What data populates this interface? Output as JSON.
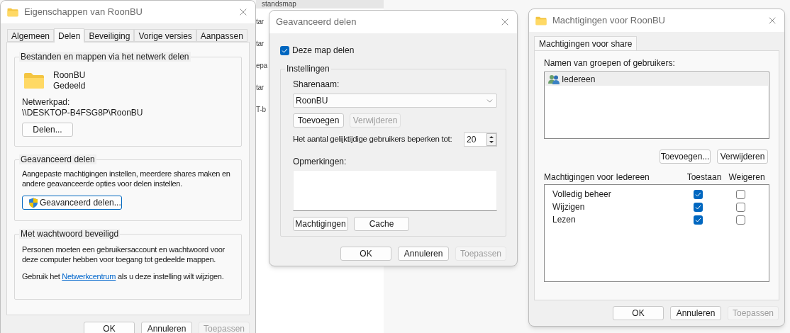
{
  "background_window": {
    "header": "standsmap",
    "items": [
      "tar",
      "tar",
      "epa",
      "tar",
      "T-b"
    ]
  },
  "properties_dialog": {
    "title": "Eigenschappen van RoonBU",
    "tabs": [
      {
        "label": "Algemeen",
        "selected": false
      },
      {
        "label": "Delen",
        "selected": true
      },
      {
        "label": "Beveiliging",
        "selected": false
      },
      {
        "label": "Vorige versies",
        "selected": false
      },
      {
        "label": "Aanpassen",
        "selected": false
      }
    ],
    "network_sharing": {
      "heading": "Bestanden en mappen via het netwerk delen",
      "folder_name": "RoonBU",
      "folder_status": "Gedeeld",
      "path_label": "Netwerkpad:",
      "path": "\\\\DESKTOP-B4FSG8P\\RoonBU",
      "share_button": "Delen..."
    },
    "advanced_sharing": {
      "heading": "Geavanceerd delen",
      "description": "Aangepaste machtigingen instellen, meerdere shares maken en andere geavanceerde opties voor delen instellen.",
      "button": "Geavanceerd delen..."
    },
    "password_protection": {
      "heading": "Met wachtwoord beveiligd",
      "description": "Personen moeten een gebruikersaccount en wachtwoord voor deze computer hebben voor toegang tot gedeelde mappen.",
      "hint_before": "Gebruik het",
      "hint_link": "Netwerkcentrum",
      "hint_after": "als u deze instelling wilt wijzigen."
    },
    "buttons": [
      {
        "label": "OK",
        "disabled": false
      },
      {
        "label": "Annuleren",
        "disabled": false
      },
      {
        "label": "Toepassen",
        "disabled": true
      }
    ]
  },
  "advanced_dialog": {
    "title": "Geavanceerd delen",
    "share_checkbox": {
      "label": "Deze map delen",
      "checked": true
    },
    "group_heading": "Instellingen",
    "share_name_label": "Sharenaam:",
    "share_name": "RoonBU",
    "add_button": {
      "label": "Toevoegen",
      "disabled": false
    },
    "remove_button": {
      "label": "Verwijderen",
      "disabled": true
    },
    "limit_label": "Het aantal gelijktijdige gebruikers beperken tot:",
    "limit_value": "20",
    "comments_label": "Opmerkingen:",
    "permissions_button": "Machtigingen",
    "cache_button": "Cache",
    "buttons": [
      {
        "label": "OK",
        "disabled": false
      },
      {
        "label": "Annuleren",
        "disabled": false
      },
      {
        "label": "Toepassen",
        "disabled": true
      }
    ]
  },
  "permissions_dialog": {
    "title": "Machtigingen voor RoonBU",
    "tabs": [
      {
        "label": "Machtigingen voor share",
        "selected": true
      }
    ],
    "users_label": "Namen van groepen of gebruikers:",
    "users": [
      {
        "name": "Iedereen",
        "selected": true
      }
    ],
    "add_button": "Toevoegen...",
    "remove_button": "Verwijderen",
    "permissions_heading": "Machtigingen voor Iedereen",
    "allow_heading": "Toestaan",
    "deny_heading": "Weigeren",
    "permissions": [
      {
        "name": "Volledig beheer",
        "allow": true,
        "deny": false
      },
      {
        "name": "Wijzigen",
        "allow": true,
        "deny": false
      },
      {
        "name": "Lezen",
        "allow": true,
        "deny": false
      }
    ],
    "buttons": [
      {
        "label": "OK",
        "disabled": false
      },
      {
        "label": "Annuleren",
        "disabled": false
      },
      {
        "label": "Toepassen",
        "disabled": true
      }
    ]
  }
}
